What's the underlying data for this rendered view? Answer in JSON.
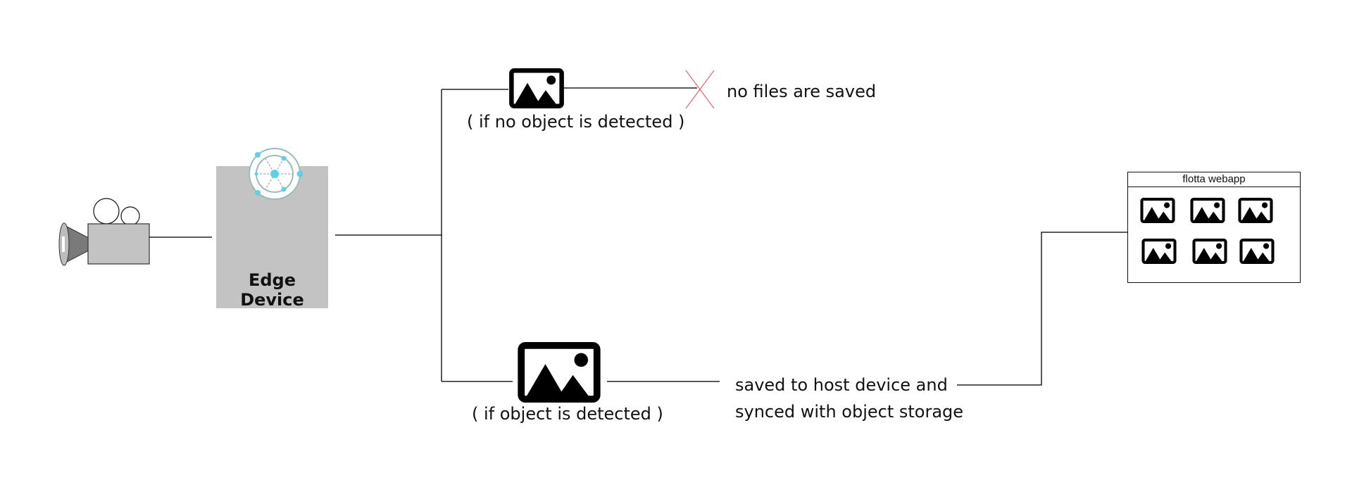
{
  "camera": {
    "icon": "video-camera-icon"
  },
  "edge_device": {
    "title": "Edge Device",
    "icon": "network-hub-icon",
    "icon_color": "#5fd0e8"
  },
  "branch_no_object": {
    "condition": "( if no object is detected )",
    "result": "no files are saved",
    "icon": "image-icon",
    "marker": "x-icon",
    "marker_color": "#d9707a"
  },
  "branch_object": {
    "condition": "( if object is detected )",
    "result_line1": "saved to host device and",
    "result_line2": "synced with object storage",
    "icon": "image-icon"
  },
  "webapp": {
    "title": "flotta webapp",
    "thumbnail_count": 6,
    "icon": "image-icon"
  }
}
